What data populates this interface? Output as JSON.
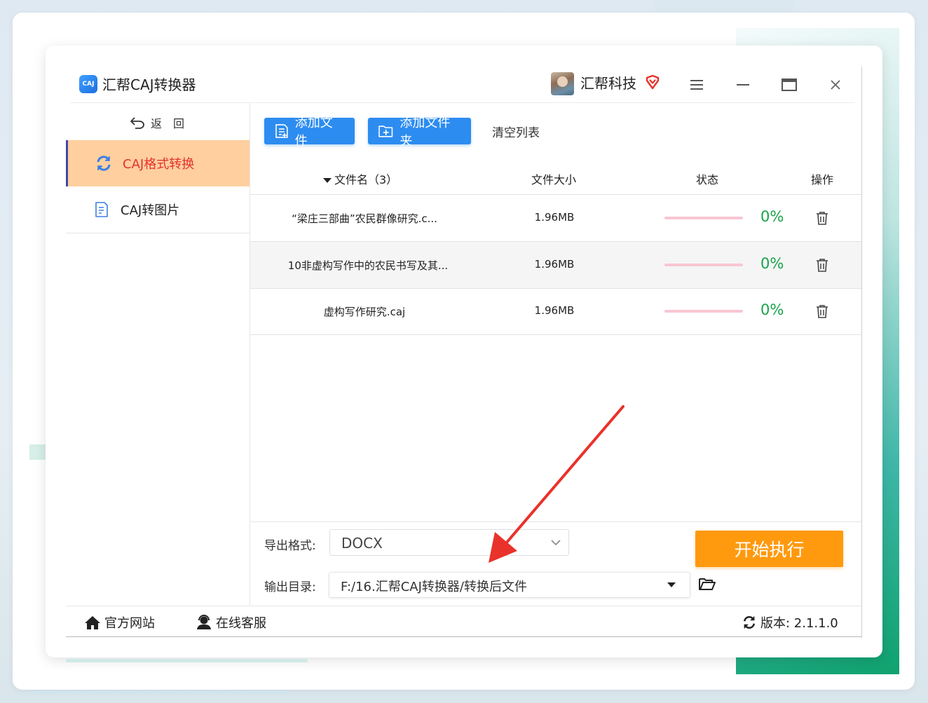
{
  "app": {
    "title": "汇帮CAJ转换器",
    "logo_text": "CAJ"
  },
  "user": {
    "name": "汇帮科技"
  },
  "sidebar": {
    "back_label": "返　回",
    "items": [
      {
        "label": "CAJ格式转换",
        "active": true
      },
      {
        "label": "CAJ转图片",
        "active": false
      }
    ]
  },
  "toolbar": {
    "add_file": "添加文件",
    "add_folder": "添加文件夹",
    "clear_list": "清空列表"
  },
  "table": {
    "headers": {
      "name": "文件名（3）",
      "size": "文件大小",
      "status": "状态",
      "action": "操作"
    },
    "rows": [
      {
        "name": "“梁庄三部曲”农民群像研究.c...",
        "size": "1.96MB",
        "progress": "0%"
      },
      {
        "name": "10非虚构写作中的农民书写及其...",
        "size": "1.96MB",
        "progress": "0%"
      },
      {
        "name": "虚构写作研究.caj",
        "size": "1.96MB",
        "progress": "0%"
      }
    ]
  },
  "export": {
    "format_label": "导出格式:",
    "format_value": "DOCX",
    "dir_label": "输出目录:",
    "dir_value": "F:/16.汇帮CAJ转换器/转换后文件",
    "start_button": "开始执行"
  },
  "footer": {
    "website": "官方网站",
    "support": "在线客服",
    "version": "版本:  2.1.1.0"
  },
  "colors": {
    "primary": "#2d8cf0",
    "active_bg": "#ffcf9f",
    "active_text": "#e4322b",
    "start_button": "#ff9a0f",
    "percent": "#19a34a",
    "annotation_arrow": "#e8322b"
  }
}
